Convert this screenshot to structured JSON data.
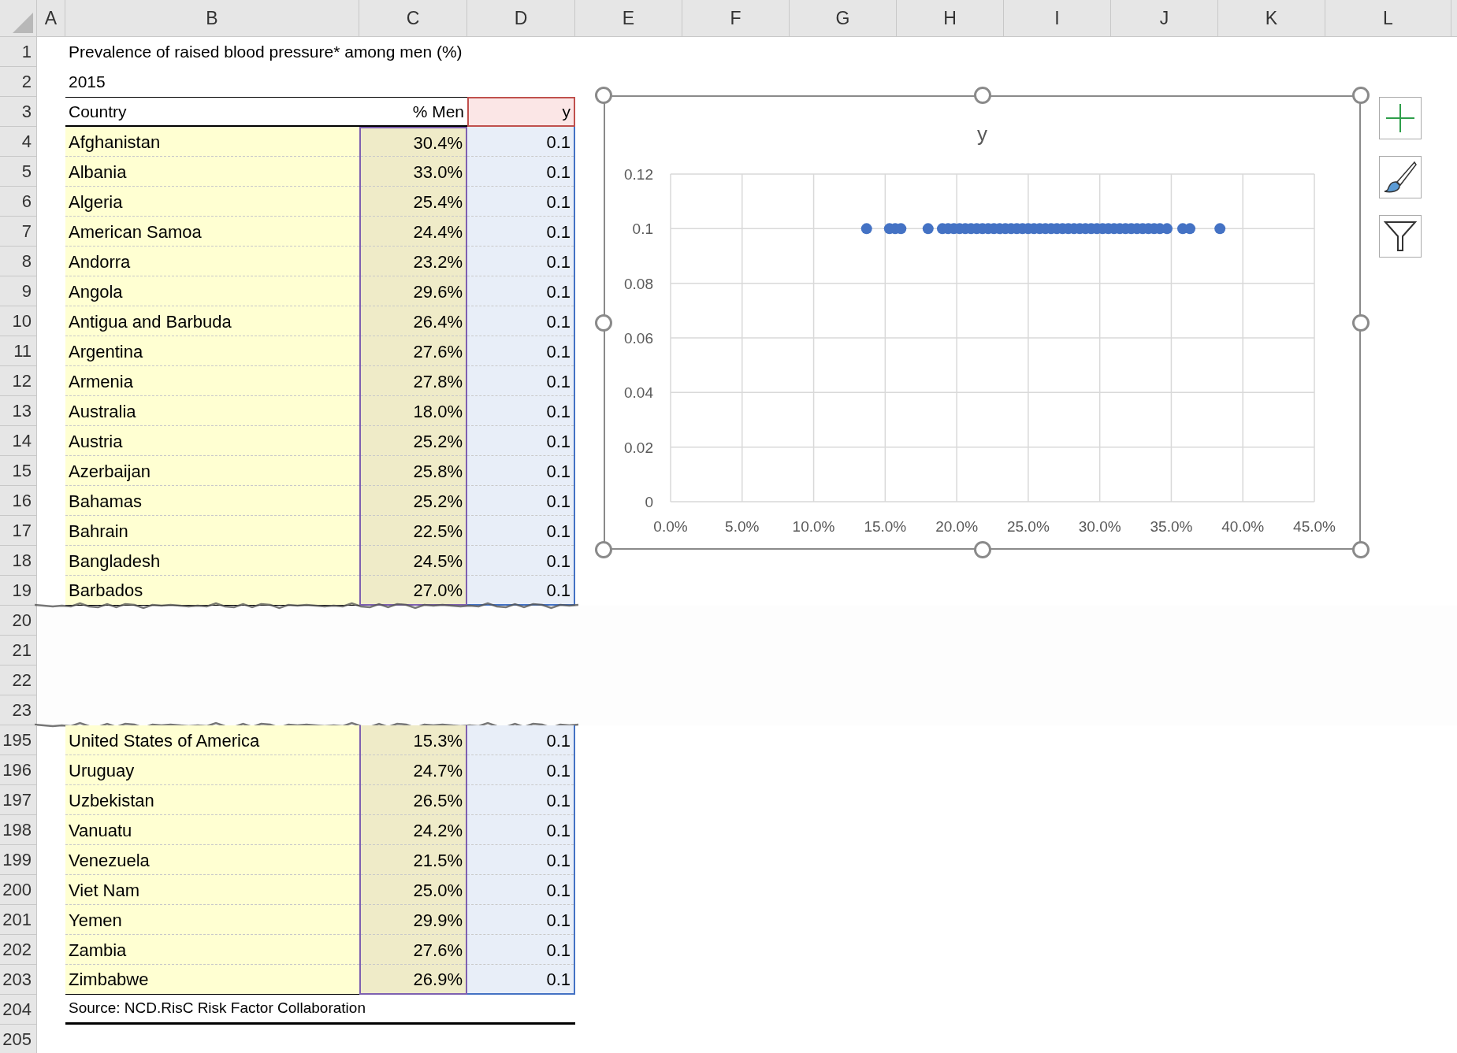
{
  "column_headers": [
    "A",
    "B",
    "C",
    "D",
    "E",
    "F",
    "G",
    "H",
    "I",
    "J",
    "K",
    "L"
  ],
  "rows": [
    {
      "number": "1",
      "kind": "title",
      "text": "Prevalence of raised blood pressure* among men (%)"
    },
    {
      "number": "2",
      "kind": "title",
      "text": "2015"
    },
    {
      "number": "3",
      "kind": "header",
      "cells": [
        "Country",
        "% Men",
        "y"
      ]
    },
    {
      "number": "4",
      "kind": "data",
      "cells": [
        "Afghanistan",
        "30.4%",
        "0.1"
      ]
    },
    {
      "number": "5",
      "kind": "data",
      "cells": [
        "Albania",
        "33.0%",
        "0.1"
      ]
    },
    {
      "number": "6",
      "kind": "data",
      "cells": [
        "Algeria",
        "25.4%",
        "0.1"
      ]
    },
    {
      "number": "7",
      "kind": "data",
      "cells": [
        "American Samoa",
        "24.4%",
        "0.1"
      ]
    },
    {
      "number": "8",
      "kind": "data",
      "cells": [
        "Andorra",
        "23.2%",
        "0.1"
      ]
    },
    {
      "number": "9",
      "kind": "data",
      "cells": [
        "Angola",
        "29.6%",
        "0.1"
      ]
    },
    {
      "number": "10",
      "kind": "data",
      "cells": [
        "Antigua and Barbuda",
        "26.4%",
        "0.1"
      ]
    },
    {
      "number": "11",
      "kind": "data",
      "cells": [
        "Argentina",
        "27.6%",
        "0.1"
      ]
    },
    {
      "number": "12",
      "kind": "data",
      "cells": [
        "Armenia",
        "27.8%",
        "0.1"
      ]
    },
    {
      "number": "13",
      "kind": "data",
      "cells": [
        "Australia",
        "18.0%",
        "0.1"
      ]
    },
    {
      "number": "14",
      "kind": "data",
      "cells": [
        "Austria",
        "25.2%",
        "0.1"
      ]
    },
    {
      "number": "15",
      "kind": "data",
      "cells": [
        "Azerbaijan",
        "25.8%",
        "0.1"
      ]
    },
    {
      "number": "16",
      "kind": "data",
      "cells": [
        "Bahamas",
        "25.2%",
        "0.1"
      ]
    },
    {
      "number": "17",
      "kind": "data",
      "cells": [
        "Bahrain",
        "22.5%",
        "0.1"
      ]
    },
    {
      "number": "18",
      "kind": "data",
      "cells": [
        "Bangladesh",
        "24.5%",
        "0.1"
      ]
    },
    {
      "number": "19",
      "kind": "data",
      "cells": [
        "Barbados",
        "27.0%",
        "0.1"
      ]
    },
    {
      "number": "20",
      "kind": "gap"
    },
    {
      "number": "21",
      "kind": "gap"
    },
    {
      "number": "22",
      "kind": "gap"
    },
    {
      "number": "23",
      "kind": "gap"
    },
    {
      "number": "195",
      "kind": "data",
      "cells": [
        "United States of America",
        "15.3%",
        "0.1"
      ]
    },
    {
      "number": "196",
      "kind": "data",
      "cells": [
        "Uruguay",
        "24.7%",
        "0.1"
      ]
    },
    {
      "number": "197",
      "kind": "data",
      "cells": [
        "Uzbekistan",
        "26.5%",
        "0.1"
      ]
    },
    {
      "number": "198",
      "kind": "data",
      "cells": [
        "Vanuatu",
        "24.2%",
        "0.1"
      ]
    },
    {
      "number": "199",
      "kind": "data",
      "cells": [
        "Venezuela",
        "21.5%",
        "0.1"
      ]
    },
    {
      "number": "200",
      "kind": "data",
      "cells": [
        "Viet Nam",
        "25.0%",
        "0.1"
      ]
    },
    {
      "number": "201",
      "kind": "data",
      "cells": [
        "Yemen",
        "29.9%",
        "0.1"
      ]
    },
    {
      "number": "202",
      "kind": "data",
      "cells": [
        "Zambia",
        "27.6%",
        "0.1"
      ]
    },
    {
      "number": "203",
      "kind": "data",
      "cells": [
        "Zimbabwe",
        "26.9%",
        "0.1"
      ]
    },
    {
      "number": "204",
      "kind": "source",
      "text": "Source: NCD.RisC Risk Factor Collaboration"
    },
    {
      "number": "205",
      "kind": "blank"
    }
  ],
  "chart": {
    "chart_data": {
      "type": "scatter",
      "grid": true,
      "xlim": [
        0,
        0.45
      ],
      "ylim": [
        0,
        0.12
      ],
      "xticks": [
        {
          "value": 0,
          "label": "0.0%"
        },
        {
          "value": 0.05,
          "label": "5.0%"
        },
        {
          "value": 0.1,
          "label": "10.0%"
        },
        {
          "value": 0.15,
          "label": "15.0%"
        },
        {
          "value": 0.2,
          "label": "20.0%"
        },
        {
          "value": 0.25,
          "label": "25.0%"
        },
        {
          "value": 0.3,
          "label": "30.0%"
        },
        {
          "value": 0.35,
          "label": "35.0%"
        },
        {
          "value": 0.4,
          "label": "40.0%"
        },
        {
          "value": 0.45,
          "label": "45.0%"
        }
      ],
      "yticks": [
        {
          "value": 0,
          "label": "0"
        },
        {
          "value": 0.02,
          "label": "0.02"
        },
        {
          "value": 0.04,
          "label": "0.04"
        },
        {
          "value": 0.06,
          "label": "0.06"
        },
        {
          "value": 0.08,
          "label": "0.08"
        },
        {
          "value": 0.1,
          "label": "0.1"
        },
        {
          "value": 0.12,
          "label": "0.12"
        }
      ],
      "x": [
        0.137,
        0.153,
        0.157,
        0.161,
        0.18,
        0.19,
        0.194,
        0.198,
        0.202,
        0.206,
        0.21,
        0.214,
        0.218,
        0.222,
        0.226,
        0.23,
        0.234,
        0.238,
        0.242,
        0.246,
        0.25,
        0.254,
        0.258,
        0.262,
        0.266,
        0.27,
        0.274,
        0.278,
        0.282,
        0.286,
        0.29,
        0.294,
        0.298,
        0.302,
        0.306,
        0.31,
        0.314,
        0.318,
        0.322,
        0.326,
        0.33,
        0.334,
        0.338,
        0.342,
        0.347,
        0.358,
        0.363,
        0.384
      ],
      "series": [
        {
          "name": "y",
          "color": "#4472c4",
          "values": [
            0.1,
            0.1,
            0.1,
            0.1,
            0.1,
            0.1,
            0.1,
            0.1,
            0.1,
            0.1,
            0.1,
            0.1,
            0.1,
            0.1,
            0.1,
            0.1,
            0.1,
            0.1,
            0.1,
            0.1,
            0.1,
            0.1,
            0.1,
            0.1,
            0.1,
            0.1,
            0.1,
            0.1,
            0.1,
            0.1,
            0.1,
            0.1,
            0.1,
            0.1,
            0.1,
            0.1,
            0.1,
            0.1,
            0.1,
            0.1,
            0.1,
            0.1,
            0.1,
            0.1,
            0.1,
            0.1,
            0.1,
            0.1
          ]
        }
      ]
    }
  }
}
